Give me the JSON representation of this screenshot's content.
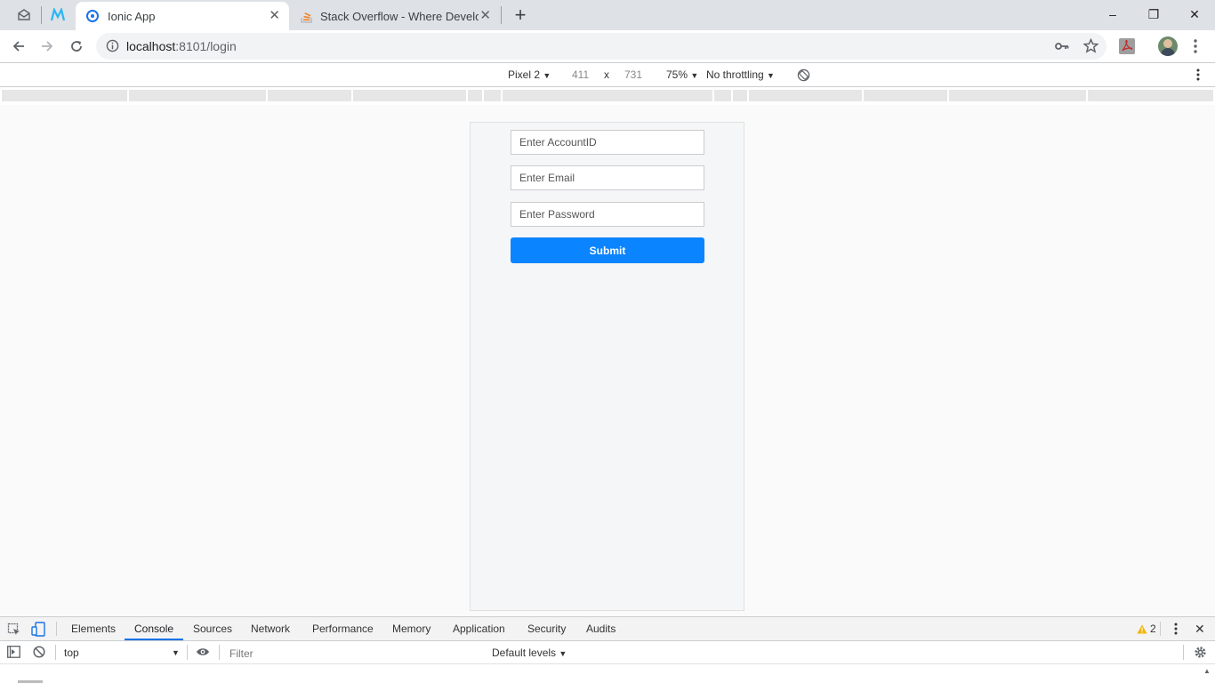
{
  "browser": {
    "tabs": [
      {
        "title": "Ionic App",
        "active": true
      },
      {
        "title": "Stack Overflow - Where Developers Learn, Share, & Build Careers",
        "active": false
      }
    ],
    "new_tab_symbol": "+",
    "window_controls": {
      "minimize": "–",
      "restore": "❐",
      "close": "✕"
    },
    "url": {
      "host": "localhost",
      "rest": ":8101/login"
    }
  },
  "device_toolbar": {
    "device": "Pixel 2",
    "width": "411",
    "times": "x",
    "height": "731",
    "zoom": "75%",
    "throttling": "No throttling"
  },
  "app": {
    "account_placeholder": "Enter AccountID",
    "email_placeholder": "Enter Email",
    "password_placeholder": "Enter Password",
    "submit_label": "Submit",
    "accent_color": "#0a84ff"
  },
  "devtools": {
    "tabs": [
      "Elements",
      "Console",
      "Sources",
      "Network",
      "Performance",
      "Memory",
      "Application",
      "Security",
      "Audits"
    ],
    "active_tab": "Console",
    "warning_count": "2",
    "context": "top",
    "filter_placeholder": "Filter",
    "levels": "Default levels"
  }
}
